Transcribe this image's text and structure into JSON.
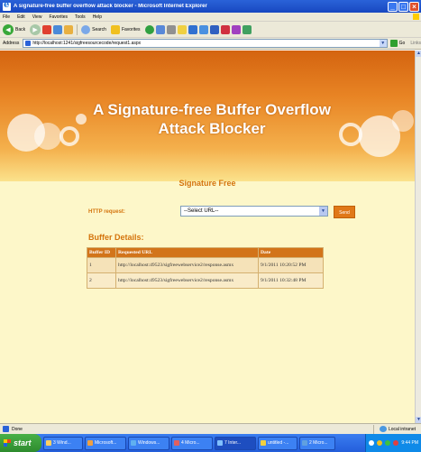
{
  "window": {
    "title": "A signature-free buffer overflow attack blocker - Microsoft Internet Explorer"
  },
  "menu": [
    "File",
    "Edit",
    "View",
    "Favorites",
    "Tools",
    "Help"
  ],
  "toolbar": {
    "back_label": "Back",
    "search_label": "Search",
    "favorites_label": "Favorites"
  },
  "address": {
    "label": "Address",
    "url": "http://localhost:1241/sigfreesourcecode/request1.aspx",
    "go_label": "Go",
    "links_label": "Links"
  },
  "page": {
    "banner_title": "A Signature-free Buffer Overflow Attack Blocker",
    "section_title": "Signature Free",
    "http_label": "HTTP request:",
    "select_value": "--Select URL--",
    "send_label": "Send",
    "buffer_title": "Buffer Details:",
    "table": {
      "headers": [
        "Buffer ID",
        "Requested URL",
        "Date"
      ],
      "rows": [
        [
          "1",
          "http://localhost:49523/sigfreewebservice2/response.asmx",
          "9/1/2011 10:20:52 PM"
        ],
        [
          "2",
          "http://localhost:49523/sigfreewebservice2/response.asmx",
          "9/1/2011 10:32:48 PM"
        ]
      ]
    }
  },
  "status": {
    "text": "Done",
    "zone": "Local intranet"
  },
  "taskbar": {
    "start_label": "start",
    "items": [
      "3 Wind...",
      "Microsoft...",
      "Windows...",
      "4 Micro...",
      "7 Inter...",
      "untitled -...",
      "2 Micro..."
    ],
    "clock": "9:44 PM"
  },
  "colors": {
    "accent": "#d4740c",
    "table_header": "#d2741a",
    "page_bg": "#fdf7c9"
  }
}
